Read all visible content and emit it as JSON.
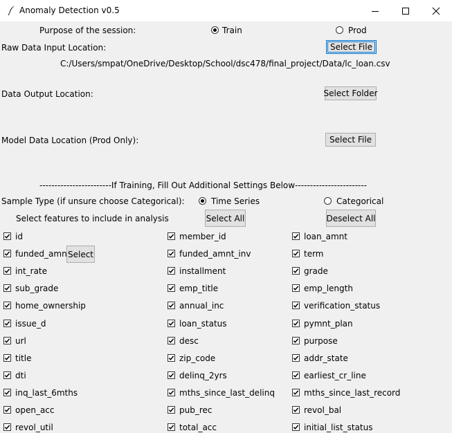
{
  "window": {
    "title": "Anomaly Detection v0.5"
  },
  "purpose": {
    "label": "Purpose of the session:",
    "options": [
      "Train",
      "Prod"
    ],
    "selected": "Train"
  },
  "raw_input": {
    "label": "Raw Data Input Location:",
    "button": "Select File",
    "path": "C:/Users/smpat/OneDrive/Desktop/School/dsc478/final_project/Data/lc_loan.csv"
  },
  "output": {
    "label": "Data Output Location:",
    "button": "Select Folder"
  },
  "model": {
    "label": "Model Data Location (Prod Only):",
    "button": "Select File"
  },
  "divider_text": "------------------------If Training, Fill Out Additional Settings Below------------------------",
  "sample_type": {
    "label": "Sample Type (if unsure choose Categorical):",
    "options": [
      "Time Series",
      "Categorical"
    ],
    "selected": "Time Series"
  },
  "features": {
    "label": "Select features to include in analysis",
    "select_all": "Select All",
    "deselect_all": "Deselect All",
    "row_select": "Select",
    "items": [
      [
        "id",
        "member_id",
        "loan_amnt"
      ],
      [
        "funded_amnt",
        "funded_amnt_inv",
        "term"
      ],
      [
        "int_rate",
        "installment",
        "grade"
      ],
      [
        "sub_grade",
        "emp_title",
        "emp_length"
      ],
      [
        "home_ownership",
        "annual_inc",
        "verification_status"
      ],
      [
        "issue_d",
        "loan_status",
        "pymnt_plan"
      ],
      [
        "url",
        "desc",
        "purpose"
      ],
      [
        "title",
        "zip_code",
        "addr_state"
      ],
      [
        "dti",
        "delinq_2yrs",
        "earliest_cr_line"
      ],
      [
        "inq_last_6mths",
        "mths_since_last_delinq",
        "mths_since_last_record"
      ],
      [
        "open_acc",
        "pub_rec",
        "revol_bal"
      ],
      [
        "revol_util",
        "total_acc",
        "initial_list_status"
      ]
    ]
  }
}
